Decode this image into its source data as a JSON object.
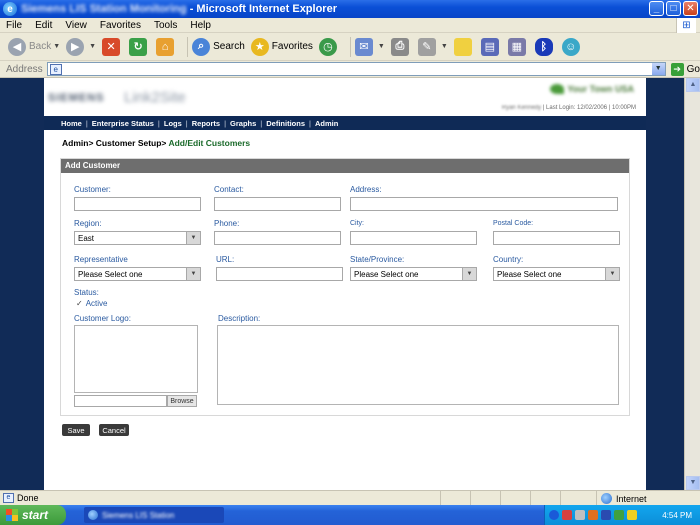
{
  "window": {
    "title_blurred": "Siemens LIS Station Monitoring",
    "title_suffix": "- Microsoft Internet Explorer"
  },
  "menu": [
    "File",
    "Edit",
    "View",
    "Favorites",
    "Tools",
    "Help"
  ],
  "toolbar": {
    "back": "Back",
    "search": "Search",
    "favorites": "Favorites"
  },
  "address": {
    "label": "Address",
    "value": "",
    "go": "Go"
  },
  "site": {
    "logo_blurred": "SIEMENS",
    "product_blurred": "Link2Site",
    "brand_blurred": "Your Town USA",
    "user_blurred": "Ryan Kennedy",
    "last_login": "| Last Login: 12/02/2006 | 10:00PM"
  },
  "nav": [
    "Home",
    "Enterprise Status",
    "Logs",
    "Reports",
    "Graphs",
    "Definitions",
    "Admin"
  ],
  "breadcrumb": {
    "part1": "Admin>",
    "part2": "Customer Setup>",
    "current": "Add/Edit Customers"
  },
  "form": {
    "heading": "Add Customer",
    "customer_label": "Customer:",
    "customer_value": "",
    "contact_label": "Contact:",
    "contact_value": "",
    "address_label": "Address:",
    "address_value": "",
    "region_label": "Region:",
    "region_value": "East",
    "phone_label": "Phone:",
    "phone_value": "",
    "city_label": "City:",
    "city_value": "",
    "postal_label": "Postal Code:",
    "postal_value": "",
    "rep_label": "Representative",
    "rep_value": "Please Select one",
    "url_label": "URL:",
    "url_value": "",
    "state_label": "State/Province:",
    "state_value": "Please Select one",
    "country_label": "Country:",
    "country_value": "Please Select one",
    "status_label": "Status:",
    "active_label": "Active",
    "active_checked": true,
    "logo_label": "Customer Logo:",
    "browse_label": "Browse",
    "description_label": "Description:"
  },
  "actions": {
    "save": "Save",
    "cancel": "Cancel"
  },
  "status": {
    "text": "Done",
    "zone": "Internet"
  },
  "taskbar": {
    "start": "start",
    "task_blurred": "Siemens LIS Station",
    "clock": "4:54 PM"
  }
}
